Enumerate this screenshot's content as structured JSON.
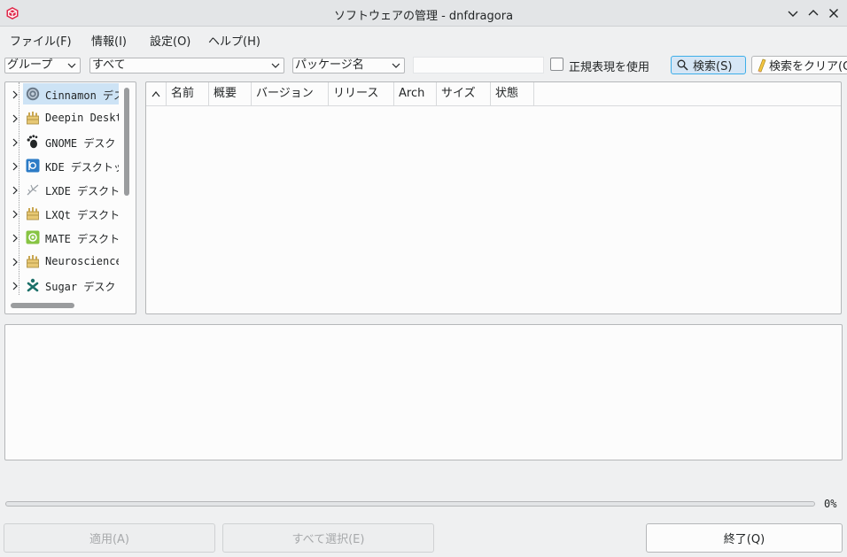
{
  "window": {
    "title": "ソフトウェアの管理 - dnfdragora",
    "app_icon": "dnfdragora-icon",
    "buttons": [
      "minimize-icon",
      "maximize-icon",
      "close-icon"
    ]
  },
  "menubar": {
    "items": [
      {
        "label": "ファイル(F)"
      },
      {
        "label": "情報(I)"
      },
      {
        "label": "設定(O)"
      },
      {
        "label": "ヘルプ(H)"
      }
    ]
  },
  "toolbar": {
    "view_combo": "グループ",
    "filter_combo": "すべて",
    "search_field_combo": "パッケージ名",
    "search_text": "",
    "regex_label": "正規表現を使用",
    "regex_checked": false,
    "search_button": "検索(S)",
    "clear_button": "検索をクリア(C"
  },
  "groups": [
    {
      "label": "Cinnamon デスクトップ",
      "icon": "cinnamon-icon",
      "selected": true
    },
    {
      "label": "Deepin Desktop",
      "icon": "package-icon",
      "selected": false
    },
    {
      "label": "GNOME デスクトップ",
      "icon": "gnome-foot-icon",
      "selected": false
    },
    {
      "label": "KDE デスクトップ",
      "icon": "kde-icon",
      "selected": false
    },
    {
      "label": "LXDE デスクトップ",
      "icon": "lxde-icon",
      "selected": false
    },
    {
      "label": "LXQt デスクトップ",
      "icon": "package-icon",
      "selected": false
    },
    {
      "label": "MATE デスクトップ",
      "icon": "mate-icon",
      "selected": false
    },
    {
      "label": "Neuroscience",
      "icon": "package-icon",
      "selected": false
    },
    {
      "label": "Sugar デスクトップ",
      "icon": "sugar-icon",
      "selected": false
    }
  ],
  "package_table": {
    "columns": [
      "名前",
      "概要",
      "バージョン",
      "リリース",
      "Arch",
      "サイズ",
      "状態"
    ],
    "rows": []
  },
  "info_text": "",
  "progress": {
    "value": 0,
    "label": "0%"
  },
  "bottom_buttons": {
    "apply": "適用(A)",
    "select_all": "すべて選択(E)",
    "quit": "終了(Q)"
  },
  "colors": {
    "accent": "#3daee9",
    "selection": "#cde3f5"
  }
}
